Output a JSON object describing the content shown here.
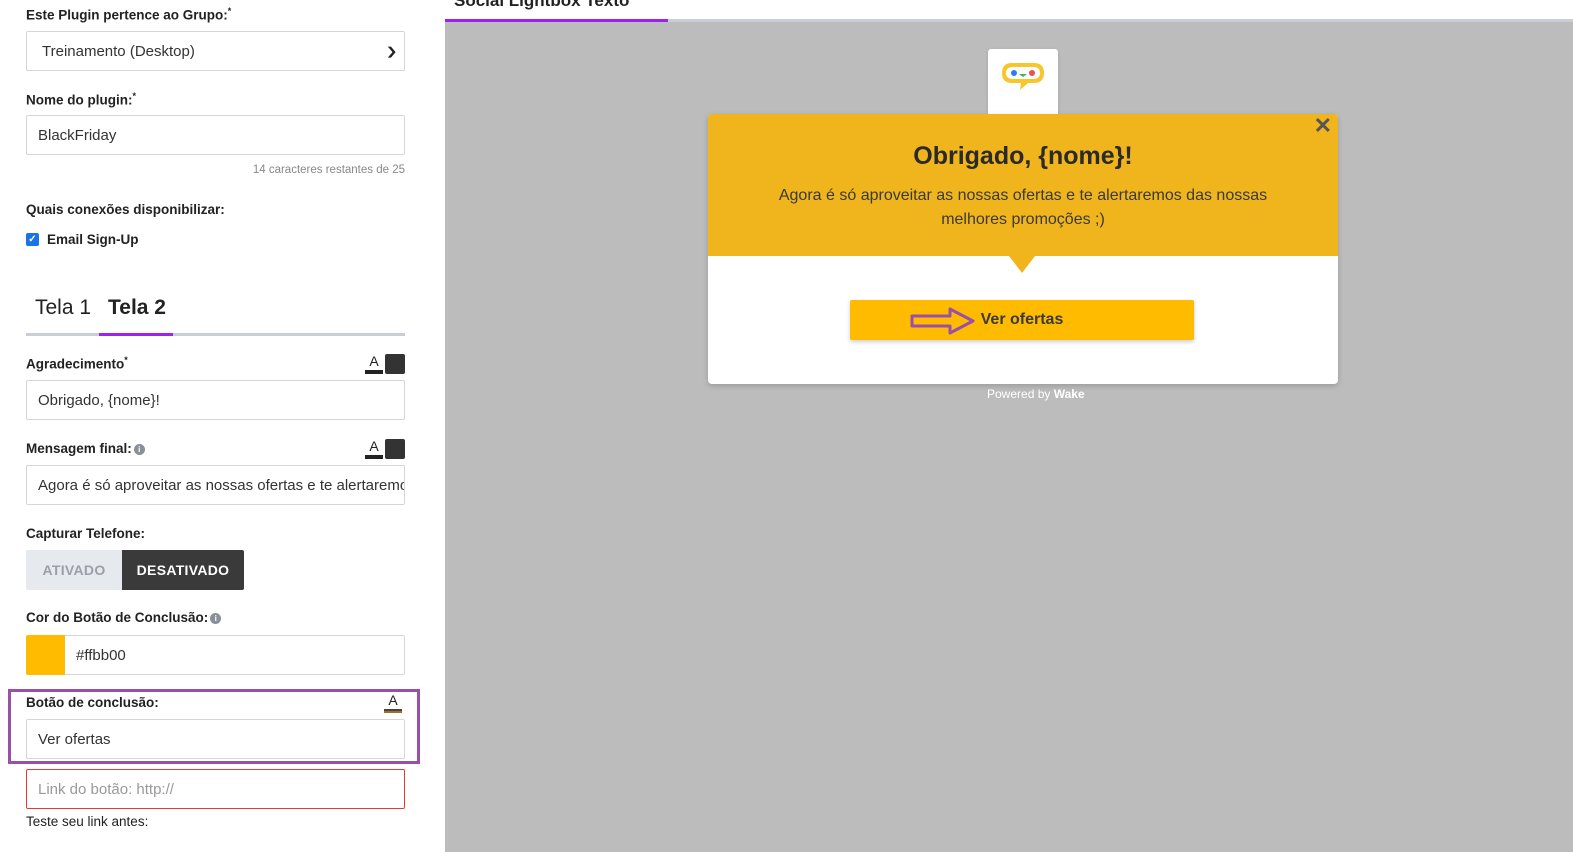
{
  "left": {
    "group_label": "Este Plugin pertence ao Grupo:",
    "required_mark": "*",
    "group_value": "Treinamento (Desktop)",
    "name_label": "Nome do plugin:",
    "name_value": "BlackFriday",
    "name_hint": "14 caracteres restantes de 25",
    "connections_label": "Quais conexões disponibilizar:",
    "connection_email": "Email Sign-Up",
    "connection_email_checked": true,
    "tabs": [
      {
        "label": "Tela 1",
        "active": false
      },
      {
        "label": "Tela 2",
        "active": true
      }
    ],
    "thanks_label": "Agradecimento",
    "thanks_value": "Obrigado, {nome}!",
    "final_msg_label": "Mensagem final:",
    "final_msg_value": "Agora é só aproveitar as nossas ofertas e te alertaremos das nossas melhores promoções ;)",
    "phone_label": "Capturar Telefone:",
    "phone_on": "ATIVADO",
    "phone_off": "DESATIVADO",
    "phone_selected": "DESATIVADO",
    "btn_color_label": "Cor do Botão de Conclusão:",
    "btn_color_value": "#ffbb00",
    "btn_text_label": "Botão de conclusão:",
    "btn_text_value": "Ver ofertas",
    "btn_link_placeholder": "Link do botão: http://",
    "test_link_note": "Teste seu link antes:"
  },
  "preview": {
    "title": "Social Lightbox Texto",
    "lightbox_title": "Obrigado, {nome}!",
    "lightbox_message": "Agora é só aproveitar as nossas ofertas e te alertaremos das nossas melhores promoções ;)",
    "button_label": "Ver ofertas",
    "powered_prefix": "Powered by",
    "powered_brand": "Wake",
    "close_glyph": "✕"
  },
  "colors": {
    "accent": "#a020f0",
    "lightbox_header": "#f0b41c",
    "button": "#ffbb00",
    "highlight": "#9b4fa8",
    "preview_bg": "#bcbcbc"
  },
  "icons": [
    "chevron-down-icon",
    "checkbox-checked-icon",
    "info-icon",
    "text-style-icon",
    "color-square-icon",
    "logo-chat-icon",
    "close-icon",
    "arrow-right-icon"
  ]
}
